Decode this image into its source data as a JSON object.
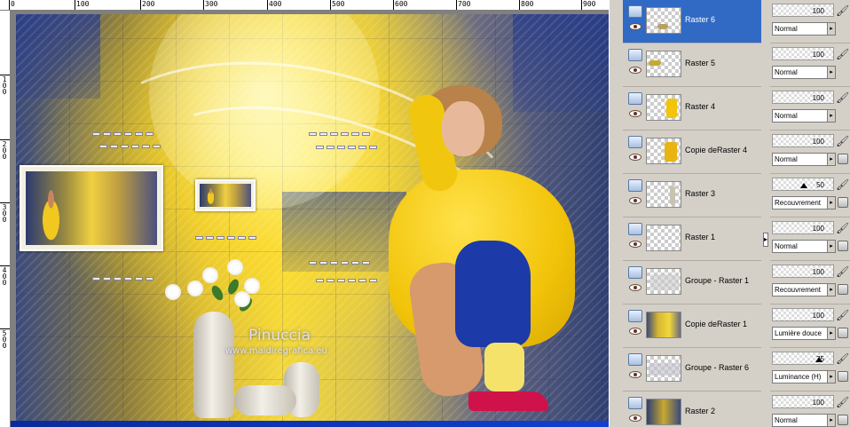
{
  "ruler": {
    "top_labels": [
      "0",
      "100",
      "200",
      "300",
      "400",
      "500",
      "600",
      "700",
      "800",
      "900"
    ],
    "left_labels": [
      "1\n0\n0",
      "2\n0\n0",
      "3\n0\n0",
      "4\n0\n0",
      "5\n0\n0"
    ]
  },
  "artwork": {
    "watermark_name": "Pinuccia",
    "watermark_url": "www.maidiregrafica.eu"
  },
  "layers": [
    {
      "name": "Raster 6",
      "opacity": "100",
      "blend": "Normal",
      "selected": true
    },
    {
      "name": "Raster 5",
      "opacity": "100",
      "blend": "Normal",
      "selected": false
    },
    {
      "name": "Raster 4",
      "opacity": "100",
      "blend": "Normal",
      "selected": false
    },
    {
      "name": "Copie deRaster 4",
      "opacity": "100",
      "blend": "Normal",
      "selected": false
    },
    {
      "name": "Raster 3",
      "opacity": "50",
      "blend": "Recouvrement",
      "selected": false
    },
    {
      "name": "Raster 1",
      "opacity": "100",
      "blend": "Normal",
      "selected": false
    },
    {
      "name": "Groupe - Raster 1",
      "opacity": "100",
      "blend": "Recouvrement",
      "selected": false
    },
    {
      "name": "Copie deRaster 1",
      "opacity": "100",
      "blend": "Lumière douce",
      "selected": false
    },
    {
      "name": "Groupe - Raster 6",
      "opacity": "75",
      "blend": "Luminance (H)",
      "selected": false
    },
    {
      "name": "Raster 2",
      "opacity": "100",
      "blend": "Normal",
      "selected": false
    }
  ],
  "colors": {
    "selection": "#316ac5",
    "panel_bg": "#d4d0c8",
    "status_strip": "#1040d0"
  },
  "icons": {
    "layer_type": "raster-layer-icon",
    "visibility": "eye-icon",
    "brush": "paintbrush-icon",
    "lock": "lock-icon",
    "collapse": "chevron-right-icon"
  }
}
